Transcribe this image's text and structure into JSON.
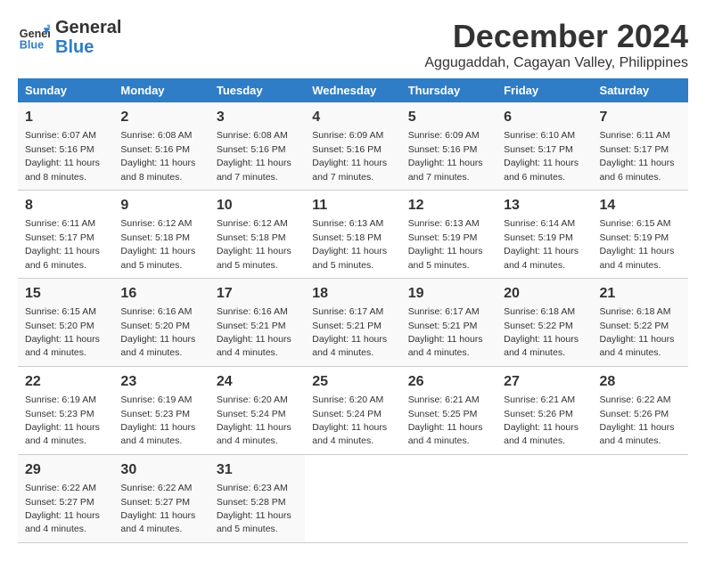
{
  "logo": {
    "line1": "General",
    "line2": "Blue"
  },
  "title": "December 2024",
  "location": "Aggugaddah, Cagayan Valley, Philippines",
  "days_of_week": [
    "Sunday",
    "Monday",
    "Tuesday",
    "Wednesday",
    "Thursday",
    "Friday",
    "Saturday"
  ],
  "weeks": [
    [
      {
        "day": "1",
        "sunrise": "6:07 AM",
        "sunset": "5:16 PM",
        "daylight": "11 hours and 8 minutes."
      },
      {
        "day": "2",
        "sunrise": "6:08 AM",
        "sunset": "5:16 PM",
        "daylight": "11 hours and 8 minutes."
      },
      {
        "day": "3",
        "sunrise": "6:08 AM",
        "sunset": "5:16 PM",
        "daylight": "11 hours and 7 minutes."
      },
      {
        "day": "4",
        "sunrise": "6:09 AM",
        "sunset": "5:16 PM",
        "daylight": "11 hours and 7 minutes."
      },
      {
        "day": "5",
        "sunrise": "6:09 AM",
        "sunset": "5:16 PM",
        "daylight": "11 hours and 7 minutes."
      },
      {
        "day": "6",
        "sunrise": "6:10 AM",
        "sunset": "5:17 PM",
        "daylight": "11 hours and 6 minutes."
      },
      {
        "day": "7",
        "sunrise": "6:11 AM",
        "sunset": "5:17 PM",
        "daylight": "11 hours and 6 minutes."
      }
    ],
    [
      {
        "day": "8",
        "sunrise": "6:11 AM",
        "sunset": "5:17 PM",
        "daylight": "11 hours and 6 minutes."
      },
      {
        "day": "9",
        "sunrise": "6:12 AM",
        "sunset": "5:18 PM",
        "daylight": "11 hours and 5 minutes."
      },
      {
        "day": "10",
        "sunrise": "6:12 AM",
        "sunset": "5:18 PM",
        "daylight": "11 hours and 5 minutes."
      },
      {
        "day": "11",
        "sunrise": "6:13 AM",
        "sunset": "5:18 PM",
        "daylight": "11 hours and 5 minutes."
      },
      {
        "day": "12",
        "sunrise": "6:13 AM",
        "sunset": "5:19 PM",
        "daylight": "11 hours and 5 minutes."
      },
      {
        "day": "13",
        "sunrise": "6:14 AM",
        "sunset": "5:19 PM",
        "daylight": "11 hours and 4 minutes."
      },
      {
        "day": "14",
        "sunrise": "6:15 AM",
        "sunset": "5:19 PM",
        "daylight": "11 hours and 4 minutes."
      }
    ],
    [
      {
        "day": "15",
        "sunrise": "6:15 AM",
        "sunset": "5:20 PM",
        "daylight": "11 hours and 4 minutes."
      },
      {
        "day": "16",
        "sunrise": "6:16 AM",
        "sunset": "5:20 PM",
        "daylight": "11 hours and 4 minutes."
      },
      {
        "day": "17",
        "sunrise": "6:16 AM",
        "sunset": "5:21 PM",
        "daylight": "11 hours and 4 minutes."
      },
      {
        "day": "18",
        "sunrise": "6:17 AM",
        "sunset": "5:21 PM",
        "daylight": "11 hours and 4 minutes."
      },
      {
        "day": "19",
        "sunrise": "6:17 AM",
        "sunset": "5:21 PM",
        "daylight": "11 hours and 4 minutes."
      },
      {
        "day": "20",
        "sunrise": "6:18 AM",
        "sunset": "5:22 PM",
        "daylight": "11 hours and 4 minutes."
      },
      {
        "day": "21",
        "sunrise": "6:18 AM",
        "sunset": "5:22 PM",
        "daylight": "11 hours and 4 minutes."
      }
    ],
    [
      {
        "day": "22",
        "sunrise": "6:19 AM",
        "sunset": "5:23 PM",
        "daylight": "11 hours and 4 minutes."
      },
      {
        "day": "23",
        "sunrise": "6:19 AM",
        "sunset": "5:23 PM",
        "daylight": "11 hours and 4 minutes."
      },
      {
        "day": "24",
        "sunrise": "6:20 AM",
        "sunset": "5:24 PM",
        "daylight": "11 hours and 4 minutes."
      },
      {
        "day": "25",
        "sunrise": "6:20 AM",
        "sunset": "5:24 PM",
        "daylight": "11 hours and 4 minutes."
      },
      {
        "day": "26",
        "sunrise": "6:21 AM",
        "sunset": "5:25 PM",
        "daylight": "11 hours and 4 minutes."
      },
      {
        "day": "27",
        "sunrise": "6:21 AM",
        "sunset": "5:26 PM",
        "daylight": "11 hours and 4 minutes."
      },
      {
        "day": "28",
        "sunrise": "6:22 AM",
        "sunset": "5:26 PM",
        "daylight": "11 hours and 4 minutes."
      }
    ],
    [
      {
        "day": "29",
        "sunrise": "6:22 AM",
        "sunset": "5:27 PM",
        "daylight": "11 hours and 4 minutes."
      },
      {
        "day": "30",
        "sunrise": "6:22 AM",
        "sunset": "5:27 PM",
        "daylight": "11 hours and 4 minutes."
      },
      {
        "day": "31",
        "sunrise": "6:23 AM",
        "sunset": "5:28 PM",
        "daylight": "11 hours and 5 minutes."
      },
      null,
      null,
      null,
      null
    ]
  ]
}
